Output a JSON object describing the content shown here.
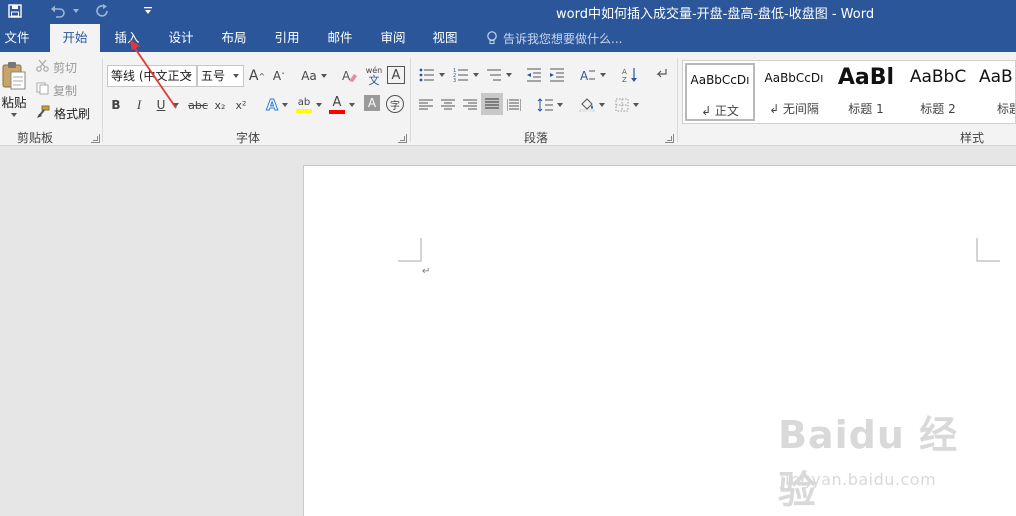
{
  "window": {
    "title": "word中如何插入成交量-开盘-盘高-盘低-收盘图 - Word",
    "qat": [
      "save-icon",
      "undo-icon",
      "redo-icon",
      "customize-qat-icon"
    ]
  },
  "tabs": [
    {
      "label": "文件"
    },
    {
      "label": "开始",
      "active": true
    },
    {
      "label": "插入"
    },
    {
      "label": "设计"
    },
    {
      "label": "布局"
    },
    {
      "label": "引用"
    },
    {
      "label": "邮件"
    },
    {
      "label": "审阅"
    },
    {
      "label": "视图"
    }
  ],
  "tell_me": {
    "placeholder": "告诉我您想要做什么..."
  },
  "clipboard": {
    "paste": "粘贴",
    "cut": "剪切",
    "copy": "复制",
    "format_painter": "格式刷",
    "label": "剪贴板"
  },
  "font": {
    "name": "等线 (中文正文",
    "size": "五号",
    "label": "字体",
    "grow": "A",
    "shrink": "A",
    "case": "Aa",
    "phonetic": "wén",
    "phonetic_char": "文",
    "char_border": "A",
    "bold": "B",
    "italic": "I",
    "underline": "U",
    "strike": "abc",
    "subscript": "x₂",
    "superscript": "x²",
    "text_effect": "A",
    "highlight": "ab",
    "font_color": "A",
    "char_shading": "A",
    "enclose": "字"
  },
  "paragraph": {
    "label": "段落"
  },
  "styles": {
    "label": "样式",
    "items": [
      {
        "sample": "AaBbCcDı",
        "name": "↲ 正文"
      },
      {
        "sample": "AaBbCcDı",
        "name": "↲ 无间隔"
      },
      {
        "sample": "AaBl",
        "name": "标题 1"
      },
      {
        "sample": "AaBbC",
        "name": "标题 2"
      },
      {
        "sample": "AaB",
        "name": "标题"
      }
    ]
  },
  "document": {
    "paragraph_mark": "↵"
  },
  "watermark": {
    "brand": "Baidu 经验",
    "url": "jingyan.baidu.com"
  },
  "colors": {
    "accent": "#2b579a",
    "highlight_bar": "#ffff00",
    "font_color_bar": "#ff0000",
    "arrow": "#e53935"
  }
}
